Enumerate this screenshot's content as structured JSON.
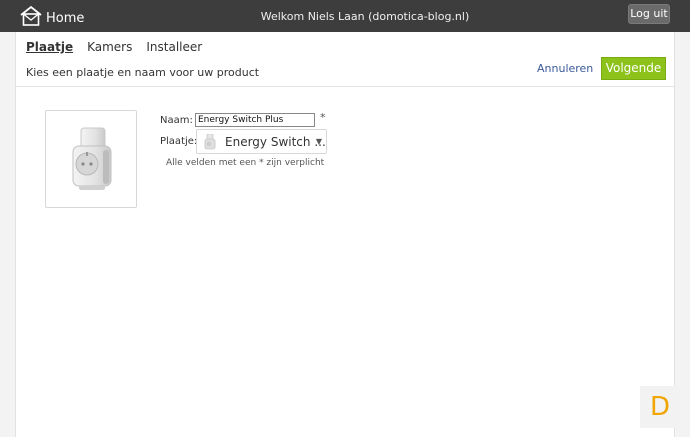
{
  "header": {
    "home_label": "Home",
    "welcome": "Welkom Niels Laan (domotica-blog.nl)",
    "logout_label": "Log uit"
  },
  "tabs": [
    {
      "label": "Plaatje",
      "active": true
    },
    {
      "label": "Kamers",
      "active": false
    },
    {
      "label": "Installeer",
      "active": false
    }
  ],
  "toolbar": {
    "subtitle": "Kies een plaatje en naam voor uw product",
    "cancel_label": "Annuleren",
    "next_label": "Volgende"
  },
  "form": {
    "name_label": "Naam:",
    "name_value": "Energy Switch Plus",
    "required_marker": "*",
    "image_label": "Plaatje:",
    "image_selected": "Energy Switch ...",
    "required_note": "Alle velden met een * zijn verplicht"
  },
  "brand": {
    "letter": "D",
    "color": "#f0a500"
  },
  "colors": {
    "topbar": "#3d3d3d",
    "accent": "#8cc21a",
    "link": "#3b5a9a"
  }
}
